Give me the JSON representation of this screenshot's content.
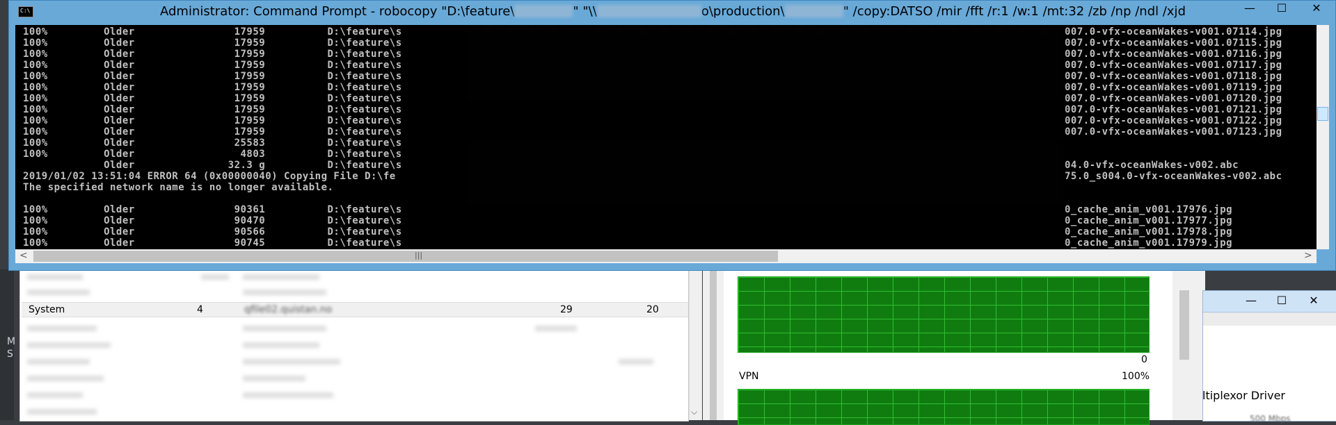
{
  "window": {
    "title_prefix": "Administrator: Command Prompt - robocopy  \"D:\\feature\\",
    "title_mid1": "\" \"\\\\",
    "title_mid2": "o\\production\\",
    "title_suffix": "\" /copy:DATSO /mir /fft /r:1 /w:1 /mt:32 /zb /np /ndl /xjd",
    "minimize_glyph": "—",
    "maximize_glyph": "☐",
    "close_glyph": "✕"
  },
  "console": {
    "lines": [
      {
        "pct": "100%",
        "status": "Older",
        "size": "17959",
        "src": "D:\\feature\\s",
        "dst": "007.0-vfx-oceanWakes-v001.07114.jpg"
      },
      {
        "pct": "100%",
        "status": "Older",
        "size": "17959",
        "src": "D:\\feature\\s",
        "dst": "007.0-vfx-oceanWakes-v001.07115.jpg"
      },
      {
        "pct": "100%",
        "status": "Older",
        "size": "17959",
        "src": "D:\\feature\\s",
        "dst": "007.0-vfx-oceanWakes-v001.07116.jpg"
      },
      {
        "pct": "100%",
        "status": "Older",
        "size": "17959",
        "src": "D:\\feature\\s",
        "dst": "007.0-vfx-oceanWakes-v001.07117.jpg"
      },
      {
        "pct": "100%",
        "status": "Older",
        "size": "17959",
        "src": "D:\\feature\\s",
        "dst": "007.0-vfx-oceanWakes-v001.07118.jpg"
      },
      {
        "pct": "100%",
        "status": "Older",
        "size": "17959",
        "src": "D:\\feature\\s",
        "dst": "007.0-vfx-oceanWakes-v001.07119.jpg"
      },
      {
        "pct": "100%",
        "status": "Older",
        "size": "17959",
        "src": "D:\\feature\\s",
        "dst": "007.0-vfx-oceanWakes-v001.07120.jpg"
      },
      {
        "pct": "100%",
        "status": "Older",
        "size": "17959",
        "src": "D:\\feature\\s",
        "dst": "007.0-vfx-oceanWakes-v001.07121.jpg"
      },
      {
        "pct": "100%",
        "status": "Older",
        "size": "17959",
        "src": "D:\\feature\\s",
        "dst": "007.0-vfx-oceanWakes-v001.07122.jpg"
      },
      {
        "pct": "100%",
        "status": "Older",
        "size": "17959",
        "src": "D:\\feature\\s",
        "dst": "007.0-vfx-oceanWakes-v001.07123.jpg"
      },
      {
        "pct": "100%",
        "status": "Older",
        "size": "25583",
        "src": "D:\\feature\\s",
        "dst": ""
      },
      {
        "pct": "100%",
        "status": "Older",
        "size": "4803",
        "src": "D:\\feature\\s",
        "dst": ""
      },
      {
        "pct": "",
        "status": "Older",
        "size": "32.3 g",
        "src": "D:\\feature\\s",
        "dst": "04.0-vfx-oceanWakes-v002.abc"
      }
    ],
    "error_line": "2019/01/02 13:51:04 ERROR 64 (0x00000040) Copying File D:\\fe",
    "error_tail": "75.0_s004.0-vfx-oceanWakes-v002.abc",
    "error_message": "The specified network name is no longer available.",
    "lines2": [
      {
        "pct": "100%",
        "status": "Older",
        "size": "90361",
        "src": "D:\\feature\\s",
        "dst": "0_cache_anim_v001.17976.jpg"
      },
      {
        "pct": "100%",
        "status": "Older",
        "size": "90470",
        "src": "D:\\feature\\s",
        "dst": "0_cache_anim_v001.17977.jpg"
      },
      {
        "pct": "100%",
        "status": "Older",
        "size": "90566",
        "src": "D:\\feature\\s",
        "dst": "0_cache_anim_v001.17978.jpg"
      },
      {
        "pct": "100%",
        "status": "Older",
        "size": "90745",
        "src": "D:\\feature\\s",
        "dst": "0_cache_anim_v001.17979.jpg"
      }
    ],
    "scroll_left": "<",
    "scroll_right": ">",
    "scroll_grip": "|||"
  },
  "process_list": {
    "row": {
      "name": "System",
      "pid": "4",
      "address": "qfile02.quistan.no",
      "col4": "29",
      "col5": "20"
    },
    "scroll_down": "⌵"
  },
  "perf": {
    "zero_label": "0",
    "vpn_label": "VPN",
    "pct_label": "100%"
  },
  "dialog": {
    "minimize": "—",
    "maximize": "☐",
    "close": "✕",
    "name": "ltiplexor Driver",
    "speed": "500 Mbps"
  },
  "edge": {
    "m": "M",
    "s": "S"
  }
}
